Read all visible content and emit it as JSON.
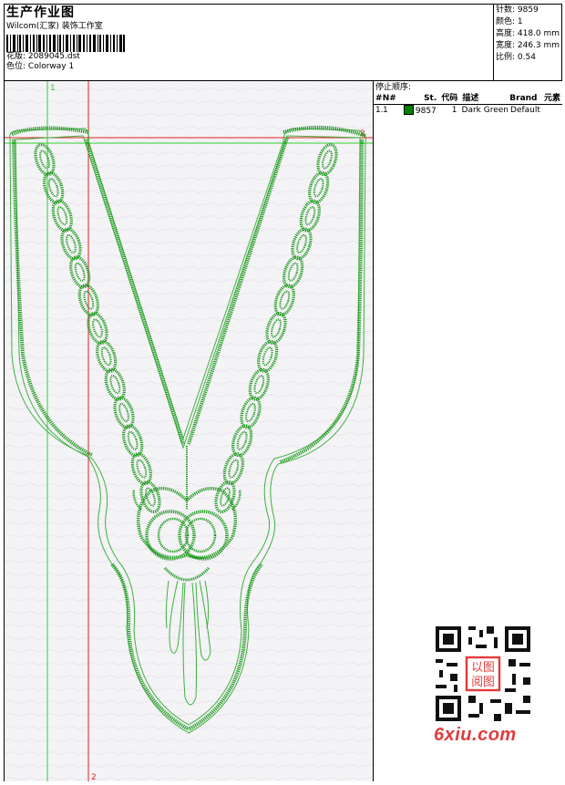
{
  "header": {
    "title": "生产作业图",
    "company": "Wilcom(汇家) 装饰工作室",
    "design_label": "花版:",
    "design_value": "2089045.dst",
    "colorway_label": "色位:",
    "colorway_value": "Colorway 1"
  },
  "stats": {
    "stitches": "针数: 9859",
    "colors": "颜色: 1",
    "height": "高度: 418.0 mm",
    "width": "宽度: 246.3 mm",
    "scale": "比例: 0.54"
  },
  "stop_sequence": {
    "title": "停止顺序:",
    "columns": {
      "hash": "#",
      "n": "N#",
      "st": "St.",
      "code": "代码",
      "desc": "描述",
      "brand": "Brand",
      "elem": "元素"
    },
    "rows": [
      {
        "hash": "1.",
        "n": "1",
        "st": "9857",
        "code": "1",
        "desc": "Dark Green",
        "brand": "Default",
        "elem": "",
        "color": "#008000"
      }
    ]
  },
  "guides": {
    "v1": "1",
    "v2": "2",
    "h2": "2"
  },
  "watermark": {
    "text": "6xiu.com",
    "stamp": "以图阅图"
  },
  "colors": {
    "thread": "#1f9a1f",
    "outline": "#40b040",
    "guide_green": "#2fcf2f",
    "guide_red": "#e02020",
    "watermark": "#e23b3b"
  }
}
